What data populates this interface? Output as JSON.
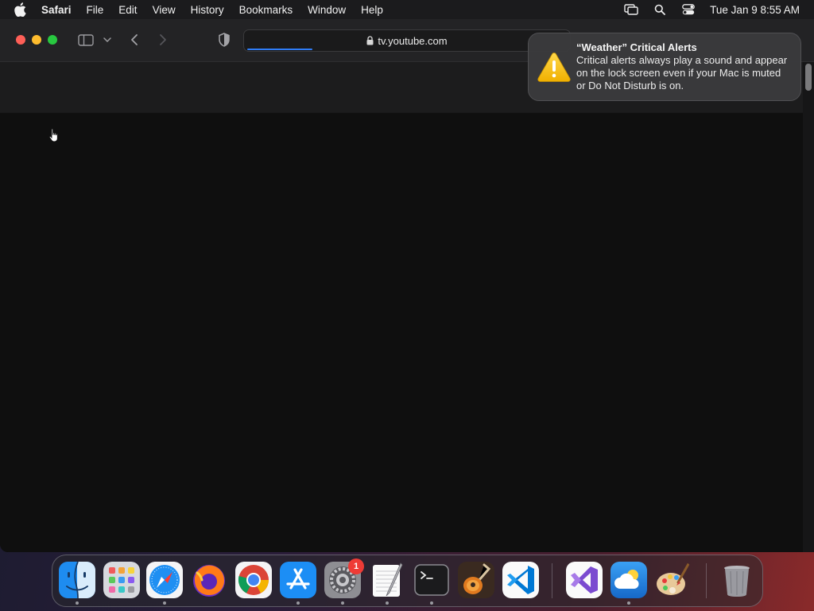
{
  "menubar": {
    "app_name": "Safari",
    "items": [
      "File",
      "Edit",
      "View",
      "History",
      "Bookmarks",
      "Window",
      "Help"
    ],
    "clock": "Tue Jan 9  8:55 AM"
  },
  "browser": {
    "url": "tv.youtube.com",
    "loading_progress": 0.2
  },
  "notification": {
    "title": "“Weather” Critical Alerts",
    "body": "Critical alerts always play a sound and appear on the lock screen even if your Mac is muted or Do Not Disturb is on."
  },
  "dock": {
    "apps": [
      "Finder",
      "Launchpad",
      "Safari",
      "Firefox",
      "Google Chrome",
      "App Store",
      "System Settings",
      "TextEdit",
      "Terminal",
      "GarageBand",
      "Visual Studio Code",
      "Visual Studio",
      "Weather",
      "Paintbrush",
      "Trash"
    ],
    "settings_badge": "1"
  },
  "colors": {
    "accent_blue": "#2f7cf6",
    "close": "#fe5f57",
    "minimize": "#febc2e",
    "maximize": "#28c840",
    "badge_red": "#ef3b36"
  }
}
